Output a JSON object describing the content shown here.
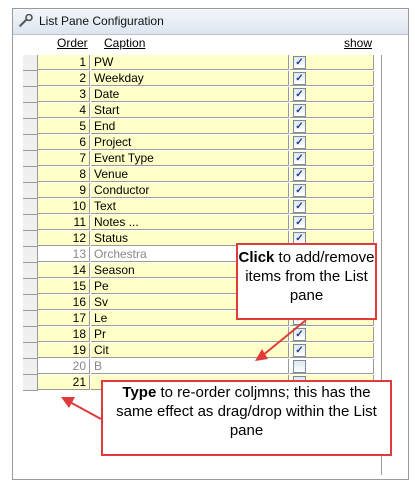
{
  "window": {
    "title": "List Pane Configuration"
  },
  "columns": {
    "order": "Order",
    "caption": "Caption",
    "show": "show"
  },
  "rows": [
    {
      "order": "1",
      "caption": "PW",
      "show": true,
      "dim": false
    },
    {
      "order": "2",
      "caption": "Weekday",
      "show": true,
      "dim": false
    },
    {
      "order": "3",
      "caption": "Date",
      "show": true,
      "dim": false
    },
    {
      "order": "4",
      "caption": "Start",
      "show": true,
      "dim": false
    },
    {
      "order": "5",
      "caption": "End",
      "show": true,
      "dim": false
    },
    {
      "order": "6",
      "caption": "Project",
      "show": true,
      "dim": false
    },
    {
      "order": "7",
      "caption": "Event Type",
      "show": true,
      "dim": false
    },
    {
      "order": "8",
      "caption": "Venue",
      "show": true,
      "dim": false
    },
    {
      "order": "9",
      "caption": "Conductor",
      "show": true,
      "dim": false
    },
    {
      "order": "10",
      "caption": "Text",
      "show": true,
      "dim": false
    },
    {
      "order": "11",
      "caption": "Notes ...",
      "show": true,
      "dim": false
    },
    {
      "order": "12",
      "caption": "Status",
      "show": true,
      "dim": false
    },
    {
      "order": "13",
      "caption": "Orchestra",
      "show": false,
      "dim": true
    },
    {
      "order": "14",
      "caption": "Season",
      "show": true,
      "dim": false
    },
    {
      "order": "15",
      "caption": "Pe",
      "show": true,
      "dim": false
    },
    {
      "order": "16",
      "caption": "Sv",
      "show": true,
      "dim": false
    },
    {
      "order": "17",
      "caption": "Le",
      "show": true,
      "dim": false
    },
    {
      "order": "18",
      "caption": "Pr",
      "show": true,
      "dim": false
    },
    {
      "order": "19",
      "caption": "Cit",
      "show": true,
      "dim": false
    },
    {
      "order": "20",
      "caption": "B",
      "show": false,
      "dim": true
    },
    {
      "order": "21",
      "caption": "",
      "show": false,
      "dim": false
    }
  ],
  "callouts": {
    "click": {
      "bold": "Click",
      "rest": " to add/remove items from the List pane"
    },
    "type": {
      "bold": "Type",
      "rest": " to re-order coljmns; this has the same effect as drag/drop within the List pane"
    }
  },
  "colors": {
    "cell_bg": "#ffffc8",
    "callout_border": "#e03a3a",
    "check": "#1b3f8f"
  },
  "icons": {
    "title": "wrench-icon",
    "checkbox": "check-icon"
  }
}
